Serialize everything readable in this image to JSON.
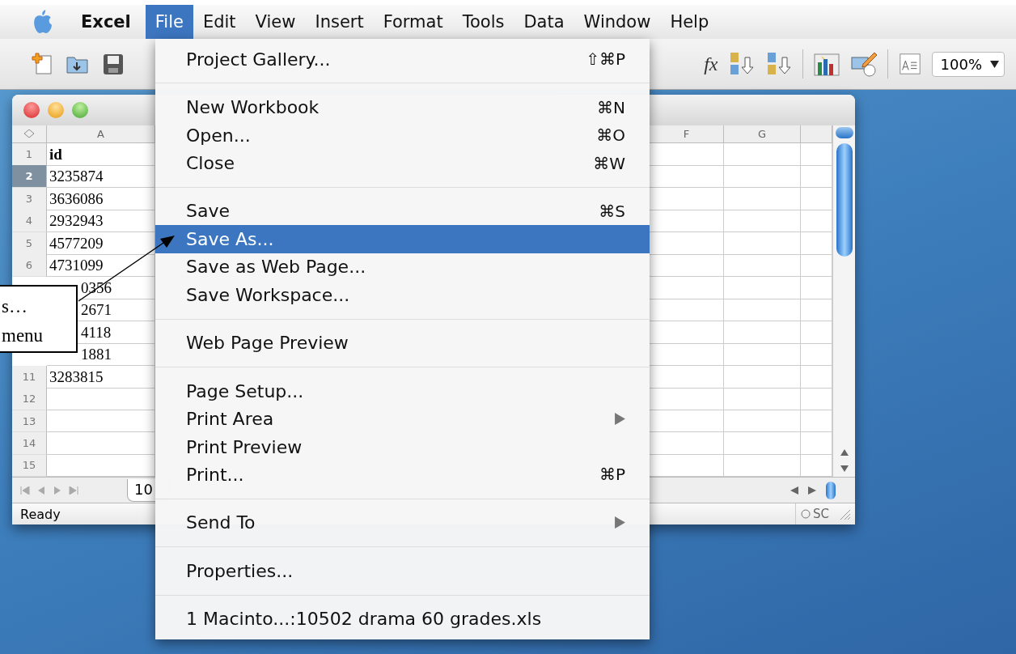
{
  "menu_bar": {
    "items": [
      {
        "label": "Excel",
        "kind": "app",
        "selected": false
      },
      {
        "label": "File",
        "kind": "menu",
        "selected": true
      },
      {
        "label": "Edit",
        "kind": "menu",
        "selected": false
      },
      {
        "label": "View",
        "kind": "menu",
        "selected": false
      },
      {
        "label": "Insert",
        "kind": "menu",
        "selected": false
      },
      {
        "label": "Format",
        "kind": "menu",
        "selected": false
      },
      {
        "label": "Tools",
        "kind": "menu",
        "selected": false
      },
      {
        "label": "Data",
        "kind": "menu",
        "selected": false
      },
      {
        "label": "Window",
        "kind": "menu",
        "selected": false
      },
      {
        "label": "Help",
        "kind": "menu",
        "selected": false
      }
    ]
  },
  "toolbar": {
    "formula_label": "fx",
    "zoom": "100%"
  },
  "workbook": {
    "columns": [
      "A",
      "F",
      "G"
    ],
    "rows": [
      {
        "number": "1",
        "cell": "id",
        "kind": "header",
        "selected": false
      },
      {
        "number": "2",
        "cell": "3235874",
        "kind": "value",
        "selected": true
      },
      {
        "number": "3",
        "cell": "3636086",
        "kind": "value",
        "selected": false
      },
      {
        "number": "4",
        "cell": "2932943",
        "kind": "value",
        "selected": false
      },
      {
        "number": "5",
        "cell": "4577209",
        "kind": "value",
        "selected": false
      },
      {
        "number": "6",
        "cell": "4731099",
        "kind": "value",
        "selected": false
      },
      {
        "cell": "0356",
        "kind": "covered"
      },
      {
        "cell": "2671",
        "kind": "covered"
      },
      {
        "cell": "4118",
        "kind": "covered"
      },
      {
        "cell": "1881",
        "kind": "covered"
      },
      {
        "number": "11",
        "cell": "3283815",
        "kind": "value",
        "selected": false
      },
      {
        "number": "12",
        "selected": false
      },
      {
        "number": "13",
        "selected": false
      },
      {
        "number": "14",
        "selected": false
      },
      {
        "number": "15",
        "selected": false
      }
    ],
    "sheet_tab": "10",
    "status": "Ready",
    "status_mode": "SC"
  },
  "file_menu": {
    "items": [
      {
        "kind": "item",
        "label": "Project Gallery...",
        "shortcut": "⇧⌘P",
        "selected": false
      },
      {
        "kind": "separator"
      },
      {
        "kind": "item",
        "label": "New Workbook",
        "shortcut": "⌘N",
        "selected": false
      },
      {
        "kind": "item",
        "label": "Open...",
        "shortcut": "⌘O",
        "selected": false
      },
      {
        "kind": "item",
        "label": "Close",
        "shortcut": "⌘W",
        "selected": false
      },
      {
        "kind": "separator"
      },
      {
        "kind": "item",
        "label": "Save",
        "shortcut": "⌘S",
        "selected": false
      },
      {
        "kind": "item",
        "label": "Save As...",
        "selected": true
      },
      {
        "kind": "item",
        "label": "Save as Web Page...",
        "selected": false
      },
      {
        "kind": "item",
        "label": "Save Workspace...",
        "selected": false
      },
      {
        "kind": "separator"
      },
      {
        "kind": "item",
        "label": "Web Page Preview",
        "selected": false
      },
      {
        "kind": "separator"
      },
      {
        "kind": "item",
        "label": "Page Setup...",
        "selected": false
      },
      {
        "kind": "submenu",
        "label": "Print Area",
        "selected": false
      },
      {
        "kind": "item",
        "label": "Print Preview",
        "selected": false
      },
      {
        "kind": "item",
        "label": "Print...",
        "shortcut": "⌘P",
        "selected": false
      },
      {
        "kind": "separator"
      },
      {
        "kind": "submenu",
        "label": "Send To",
        "selected": false
      },
      {
        "kind": "separator"
      },
      {
        "kind": "item",
        "label": "Properties...",
        "selected": false
      },
      {
        "kind": "separator"
      },
      {
        "kind": "item",
        "label": "1 Macinto...:10502 drama 60 grades.xls",
        "selected": false
      }
    ]
  },
  "callout": {
    "lines": [
      "s…",
      "menu"
    ]
  }
}
